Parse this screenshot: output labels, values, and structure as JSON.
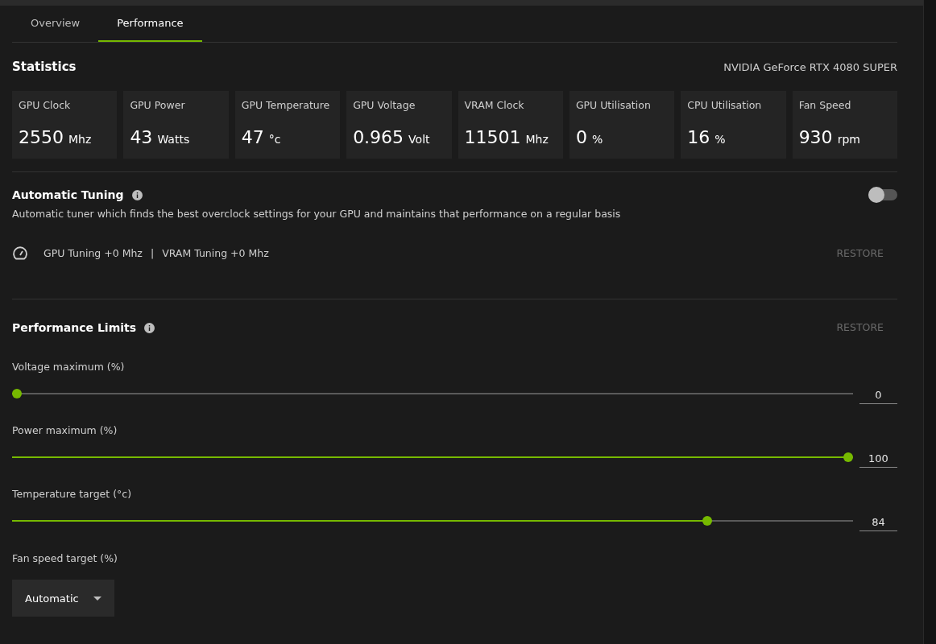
{
  "tabs": [
    {
      "label": "Overview",
      "selected": false
    },
    {
      "label": "Performance",
      "selected": true
    }
  ],
  "statistics": {
    "title": "Statistics",
    "device": "NVIDIA GeForce RTX 4080 SUPER",
    "cards": [
      {
        "label": "GPU Clock",
        "value": "2550",
        "unit": "Mhz"
      },
      {
        "label": "GPU Power",
        "value": "43",
        "unit": "Watts"
      },
      {
        "label": "GPU Temperature",
        "value": "47",
        "unit": "°c"
      },
      {
        "label": "GPU Voltage",
        "value": "0.965",
        "unit": "Volt"
      },
      {
        "label": "VRAM Clock",
        "value": "11501",
        "unit": "Mhz"
      },
      {
        "label": "GPU Utilisation",
        "value": "0",
        "unit": "%"
      },
      {
        "label": "CPU Utilisation",
        "value": "16",
        "unit": "%"
      },
      {
        "label": "Fan Speed",
        "value": "930",
        "unit": "rpm"
      }
    ]
  },
  "automatic_tuning": {
    "title": "Automatic Tuning",
    "on": false,
    "description": "Automatic tuner which finds the best overclock settings for your GPU and maintains that performance on a regular basis",
    "gpu_tuning": "GPU Tuning +0 Mhz",
    "separator": "|",
    "vram_tuning": "VRAM Tuning +0 Mhz",
    "restore": "RESTORE"
  },
  "performance_limits": {
    "title": "Performance Limits",
    "restore": "RESTORE",
    "sliders": [
      {
        "label": "Voltage maximum (%)",
        "level": 0,
        "value": "0"
      },
      {
        "label": "Power maximum (%)",
        "level": 1,
        "value": "100"
      },
      {
        "label": "Temperature target (°c)",
        "level": 0.83,
        "value": "84"
      }
    ],
    "fan_speed": {
      "label": "Fan speed target (%)",
      "value": "Automatic"
    }
  }
}
